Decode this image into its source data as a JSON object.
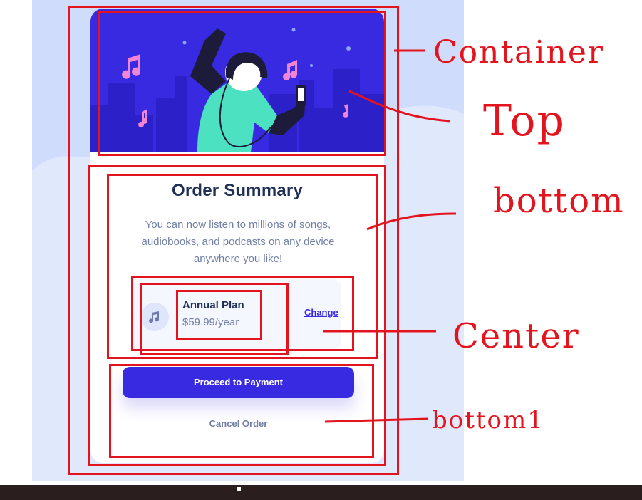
{
  "card": {
    "title": "Order Summary",
    "description": "You can now listen to millions of songs, audiobooks, and podcasts on any device anywhere you like!",
    "plan": {
      "name": "Annual Plan",
      "price": "$59.99/year",
      "change_label": "Change",
      "icon": "music-note-icon"
    },
    "primary_button": "Proceed to Payment",
    "secondary_button": "Cancel Order"
  },
  "annotations": {
    "container": "Container",
    "top": "Top",
    "bottom": "bottom",
    "center": "Center",
    "bottom1": "bottom1"
  },
  "colors": {
    "accent": "#382ae1",
    "heading": "#1f2f56",
    "muted": "#717fa6",
    "page_bg": "#e0e8fc",
    "annotation": "#e4141e"
  }
}
